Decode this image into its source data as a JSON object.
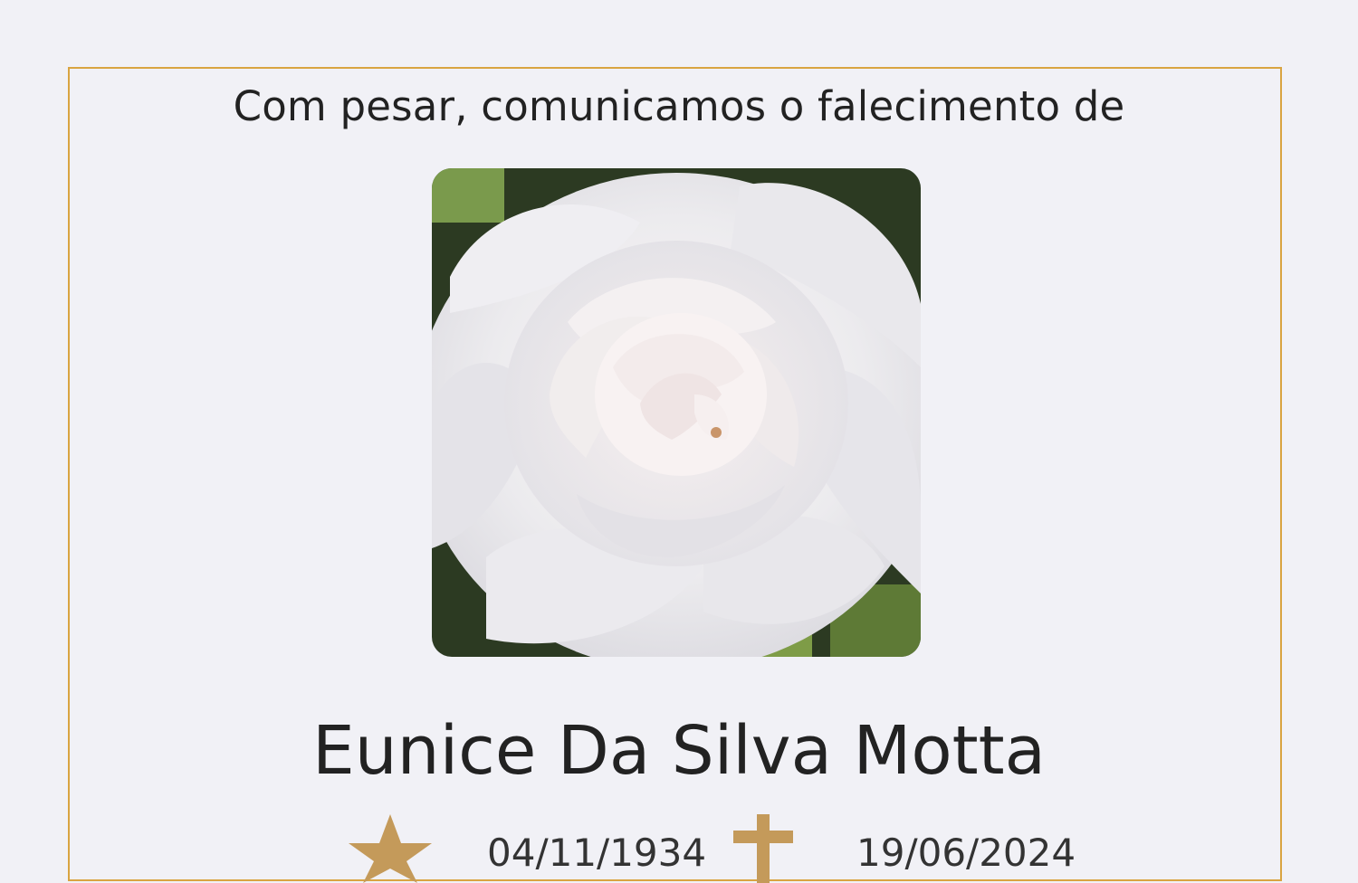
{
  "notice": {
    "intro": "Com pesar, comunicamos o falecimento de",
    "name": "Eunice Da Silva Motta",
    "birth_icon": "star-icon",
    "birth_date": "04/11/1934",
    "death_icon": "cross-icon",
    "death_date": "19/06/2024",
    "photo": "white-rose-photo"
  },
  "colors": {
    "border": "#d9a441",
    "icon": "#c49a5a",
    "background": "#f1f1f6",
    "text": "#222222"
  }
}
